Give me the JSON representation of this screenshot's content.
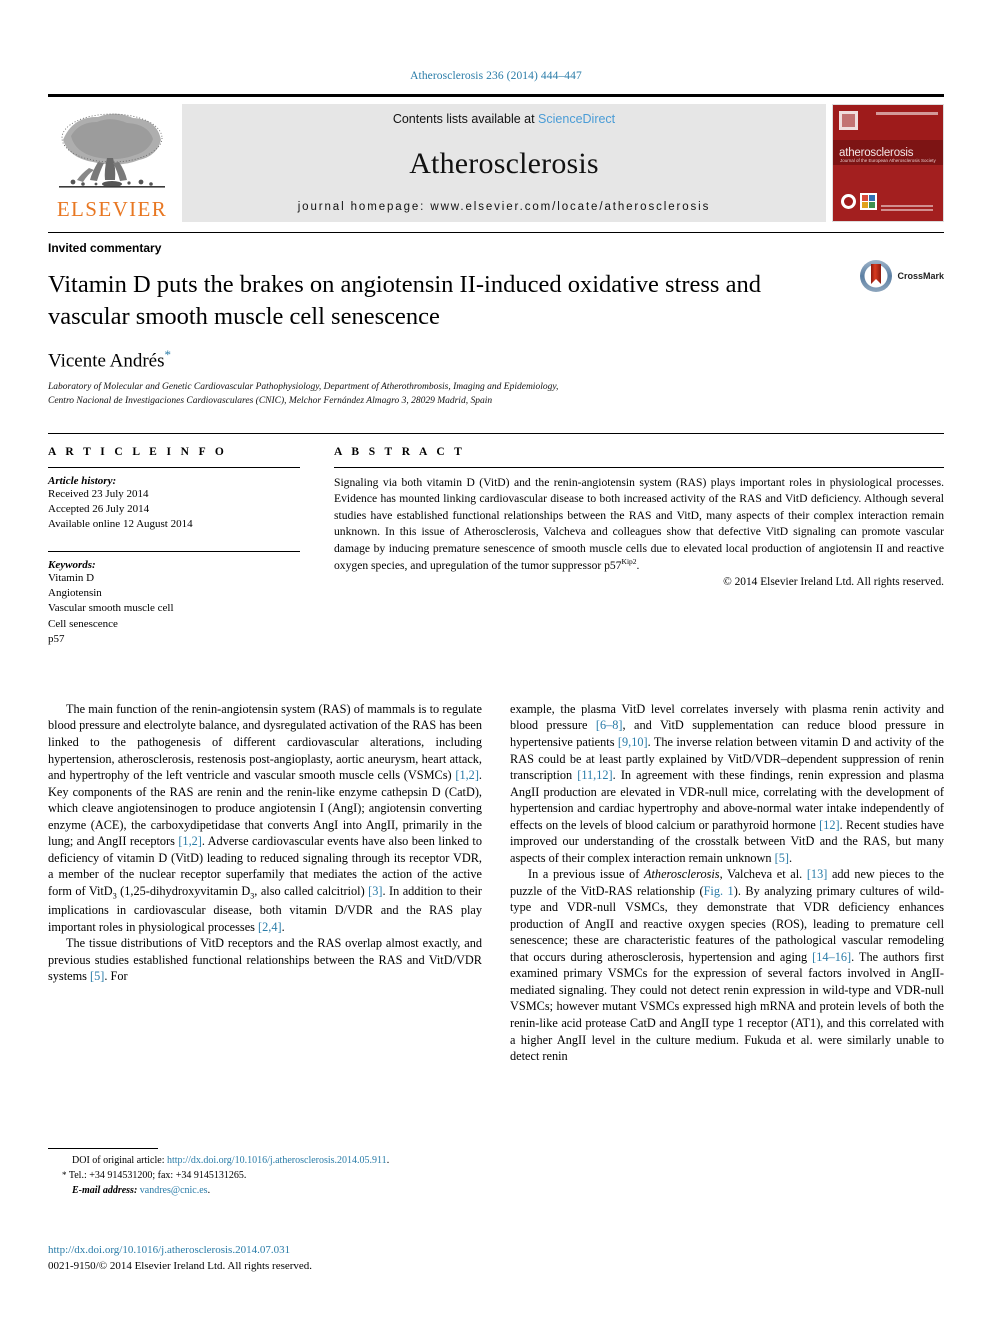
{
  "running_head": "Atherosclerosis 236 (2014) 444–447",
  "masthead": {
    "publisher_name": "ELSEVIER",
    "contents_prefix": "Contents lists available at ",
    "sciencedirect": "ScienceDirect",
    "journal_name": "Atherosclerosis",
    "homepage": "journal homepage: www.elsevier.com/locate/atherosclerosis",
    "cover": {
      "title": "atherosclerosis",
      "subtitle": "Journal of the European Atherosclerosis Society"
    }
  },
  "article": {
    "kicker": "Invited commentary",
    "title": "Vitamin D puts the brakes on angiotensin II-induced oxidative stress and vascular smooth muscle cell senescence",
    "crossmark_label": "CrossMark",
    "author": "Vicente Andrés",
    "author_marker": "*",
    "affiliation_line1": "Laboratory of Molecular and Genetic Cardiovascular Pathophysiology, Department of Atherothrombosis, Imaging and Epidemiology,",
    "affiliation_line2": "Centro Nacional de Investigaciones Cardiovasculares (CNIC), Melchor Fernández Almagro 3, 28029 Madrid, Spain"
  },
  "info": {
    "heading": "A R T I C L E   I N F O",
    "history_label": "Article history:",
    "received": "Received 23 July 2014",
    "accepted": "Accepted 26 July 2014",
    "available": "Available online 12 August 2014",
    "keywords_label": "Keywords:",
    "keywords": [
      "Vitamin D",
      "Angiotensin",
      "Vascular smooth muscle cell",
      "Cell senescence",
      "p57"
    ]
  },
  "abstract": {
    "heading": "A B S T R A C T",
    "part1": "Signaling via both vitamin D (VitD) and the renin-angiotensin system (RAS) plays important roles in physiological processes. Evidence has mounted linking cardiovascular disease to both increased activity of the RAS and VitD deficiency. Although several studies have established functional relationships between the RAS and VitD, many aspects of their complex interaction remain unknown. In this issue of Atherosclerosis, Valcheva and colleagues show that defective VitD signaling can promote vascular damage by inducing premature senescence of smooth muscle cells due to elevated local production of angiotensin II and reactive oxygen species, and upregulation of the tumor suppressor p57",
    "superscript": "Kip2",
    "part2": ".",
    "copyright": "© 2014 Elsevier Ireland Ltd. All rights reserved."
  },
  "body": {
    "left": {
      "p1_a": "The main function of the renin-angiotensin system (RAS) of mammals is to regulate blood pressure and electrolyte balance, and dysregulated activation of the RAS has been linked to the pathogenesis of different cardiovascular alterations, including hypertension, atherosclerosis, restenosis post-angioplasty, aortic aneurysm, heart attack, and hypertrophy of the left ventricle and vascular smooth muscle cells (VSMCs) ",
      "ref1": "[1,2]",
      "p1_b": ". Key components of the RAS are renin and the renin-like enzyme cathepsin D (CatD), which cleave angiotensinogen to produce angiotensin I (AngI); angiotensin converting enzyme (ACE), the carboxydipetidase that converts AngI into AngII, primarily in the lung; and AngII receptors ",
      "ref2": "[1,2]",
      "p1_c": ". Adverse cardiovascular events have also been linked to deficiency of vitamin D (VitD) leading to reduced signaling through its receptor VDR, a member of the nuclear receptor superfamily that mediates the action of the active form of VitD",
      "sub3_1": "3",
      "p1_d": " (1,25-dihydroxyvitamin D",
      "sub3_2": "3",
      "p1_e": ", also called calcitriol) ",
      "ref3": "[3]",
      "p1_f": ". In addition to their implications in cardiovascular disease, both vitamin D/VDR and the RAS play important roles in physiological processes ",
      "ref4": "[2,4]",
      "p1_g": ".",
      "p2_a": "The tissue distributions of VitD receptors and the RAS overlap almost exactly, and previous studies established functional relationships between the RAS and VitD/VDR systems ",
      "ref5": "[5]",
      "p2_b": ". For"
    },
    "right": {
      "p1_a": "example, the plasma VitD level correlates inversely with plasma renin activity and blood pressure ",
      "ref6": "[6–8]",
      "p1_b": ", and VitD supplementation can reduce blood pressure in hypertensive patients ",
      "ref7": "[9,10]",
      "p1_c": ". The inverse relation between vitamin D and activity of the RAS could be at least partly explained by VitD/VDR–dependent suppression of renin transcription ",
      "ref8": "[11,12]",
      "p1_d": ". In agreement with these findings, renin expression and plasma AngII production are elevated in VDR-null mice, correlating with the development of hypertension and cardiac hypertrophy and above-normal water intake independently of effects on the levels of blood calcium or parathyroid hormone ",
      "ref9": "[12]",
      "p1_e": ". Recent studies have improved our understanding of the crosstalk between VitD and the RAS, but many aspects of their complex interaction remain unknown ",
      "ref10": "[5]",
      "p1_f": ".",
      "p2_a": "In a previous issue of ",
      "p2_italic": "Atherosclerosis",
      "p2_b": ", Valcheva et al. ",
      "ref11": "[13]",
      "p2_c": " add new pieces to the puzzle of the VitD-RAS relationship (",
      "figref": "Fig. 1",
      "p2_d": "). By analyzing primary cultures of wild-type and VDR-null VSMCs, they demonstrate that VDR deficiency enhances production of AngII and reactive oxygen species (ROS), leading to premature cell senescence; these are characteristic features of the pathological vascular remodeling that occurs during atherosclerosis, hypertension and aging ",
      "ref12": "[14–16]",
      "p2_e": ". The authors first examined primary VSMCs for the expression of several factors involved in AngII-mediated signaling. They could not detect renin expression in wild-type and VDR-null VSMCs; however mutant VSMCs expressed high mRNA and protein levels of both the renin-like acid protease CatD and AngII type 1 receptor (AT1), and this correlated with a higher AngII level in the culture medium. Fukuda et al. were similarly unable to detect renin"
    }
  },
  "footnotes": {
    "doi_label": "DOI of original article: ",
    "doi_link": "http://dx.doi.org/10.1016/j.atherosclerosis.2014.05.911",
    "doi_end": ".",
    "tel_bullet": "*",
    "tel": "Tel.: +34 914531200; fax: +34 9145131265.",
    "email_label": "E-mail address: ",
    "email": "vandres@cnic.es",
    "email_end": ".",
    "bottom_doi": "http://dx.doi.org/10.1016/j.atherosclerosis.2014.07.031",
    "bottom_copyright": "0021-9150/© 2014 Elsevier Ireland Ltd. All rights reserved."
  },
  "colors": {
    "link": "#2a7ca8",
    "sciencedirect": "#4a9cd6",
    "elsevier_orange": "#e87722",
    "cover_red": "#9e1b1b",
    "band_gray": "#e6e6e6"
  }
}
